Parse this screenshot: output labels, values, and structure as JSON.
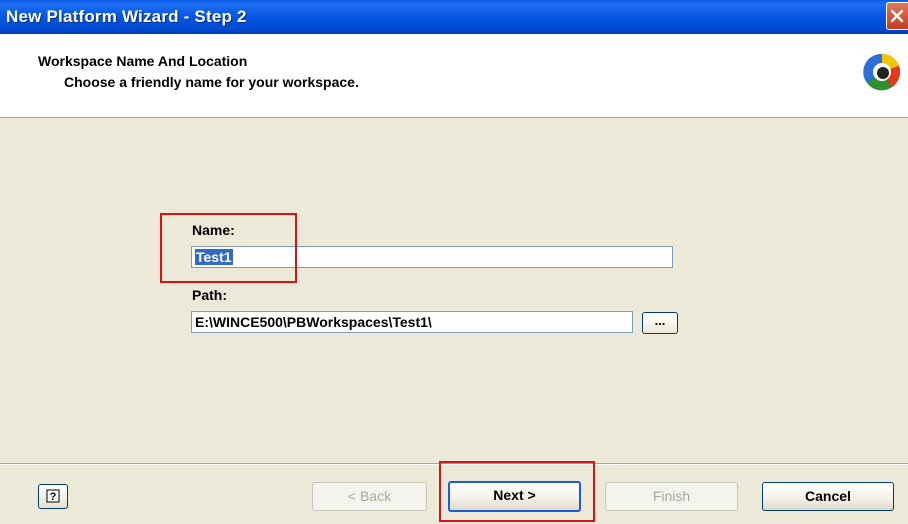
{
  "window": {
    "title": "New Platform Wizard - Step 2"
  },
  "header": {
    "title": "Workspace Name And Location",
    "subtitle": "Choose a friendly name for your workspace."
  },
  "form": {
    "name_label": "Name:",
    "name_value": "Test1",
    "path_label": "Path:",
    "path_value": "E:\\WINCE500\\PBWorkspaces\\Test1\\",
    "browse_label": "..."
  },
  "buttons": {
    "back": "< Back",
    "next": "Next >",
    "finish": "Finish",
    "cancel": "Cancel"
  },
  "icons": {
    "close": "close-icon",
    "help": "help-icon",
    "wizard_logo": "wizard-logo-icon"
  },
  "colors": {
    "titlebar": "#0556e2",
    "body_bg": "#ece9d8",
    "selection": "#316ac5",
    "highlight_box": "#e01010"
  }
}
